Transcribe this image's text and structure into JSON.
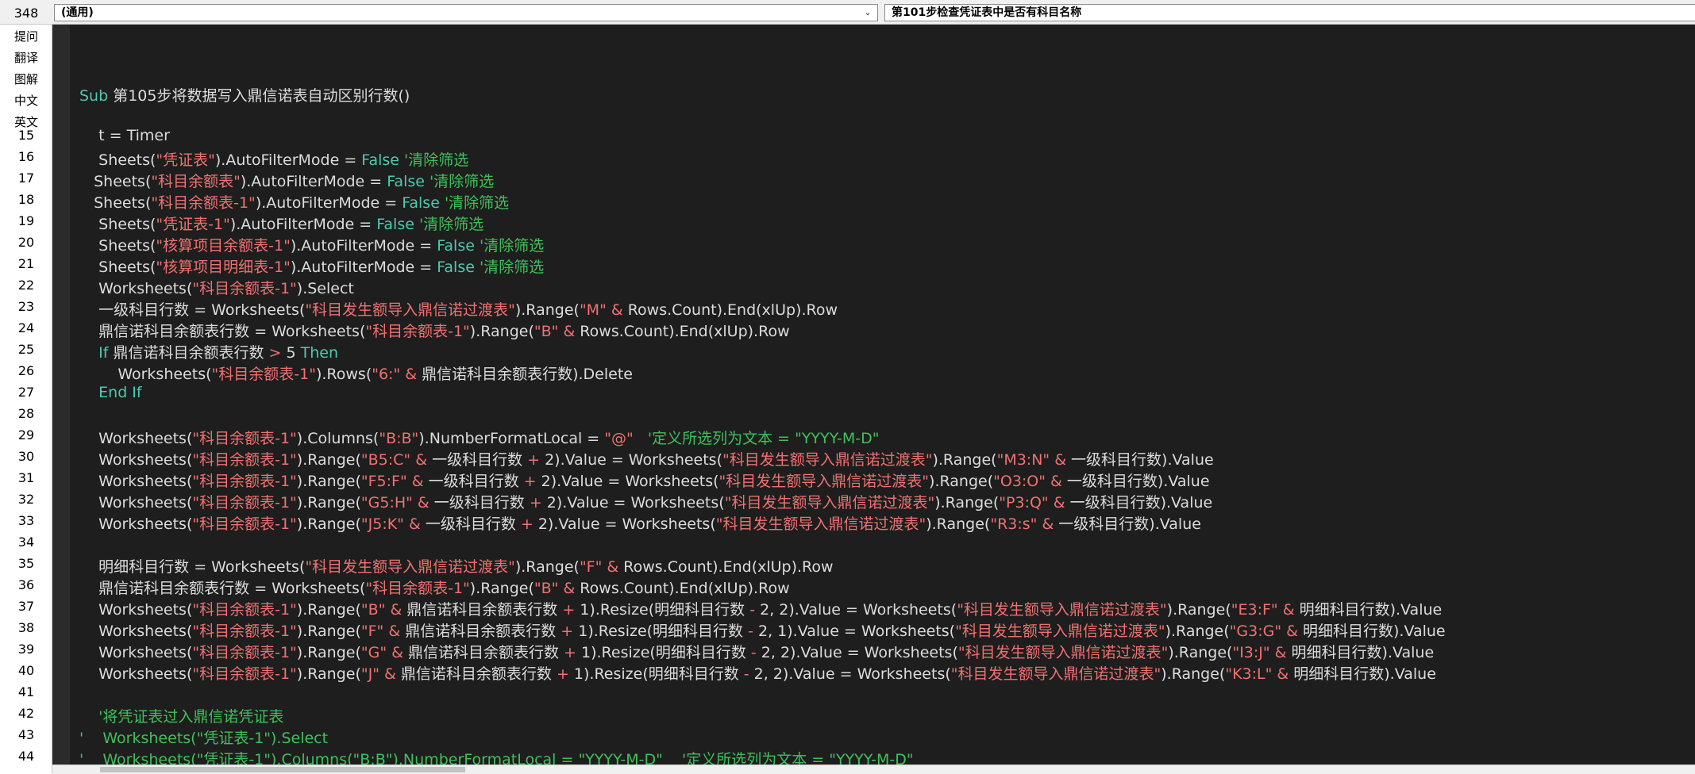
{
  "toolbar": {
    "line_number": "348"
  },
  "object_combo": {
    "value": "(通用)"
  },
  "proc_combo": {
    "value": "第101步检查凭证表中是否有科目名称"
  },
  "sidebar": {
    "tools": [
      "提问",
      "翻译",
      "图解",
      "中文",
      "英文"
    ]
  },
  "line_numbers": [
    "15",
    "16",
    "17",
    "18",
    "19",
    "20",
    "21",
    "22",
    "23",
    "24",
    "25",
    "26",
    "27",
    "28",
    "29",
    "30",
    "31",
    "32",
    "33",
    "34",
    "35",
    "36",
    "37",
    "38",
    "39",
    "40",
    "41",
    "42",
    "43",
    "44"
  ],
  "colors": {
    "keyword": "#4ec9b0",
    "string": "#f07171",
    "comment": "#3fc05a",
    "text": "#dcdcdc",
    "background": "#1e1e1e"
  },
  "code_lines": [
    [],
    [
      [
        "k",
        "Sub"
      ],
      [
        "t",
        " 第105步将数据写入鼎信诺表自动区别行数()"
      ]
    ],
    [],
    [
      [
        "t",
        "    t = Timer"
      ]
    ],
    [
      [
        "t",
        "    Sheets("
      ],
      [
        "s",
        "\"凭证表\""
      ],
      [
        "t",
        ").AutoFilterMode = "
      ],
      [
        "k",
        "False"
      ],
      [
        "c",
        " '清除筛选"
      ]
    ],
    [
      [
        "t",
        "   Sheets("
      ],
      [
        "s",
        "\"科目余额表\""
      ],
      [
        "t",
        ").AutoFilterMode = "
      ],
      [
        "k",
        "False"
      ],
      [
        "c",
        " '清除筛选"
      ]
    ],
    [
      [
        "t",
        "   Sheets("
      ],
      [
        "s",
        "\"科目余额表-1\""
      ],
      [
        "t",
        ").AutoFilterMode = "
      ],
      [
        "k",
        "False"
      ],
      [
        "c",
        " '清除筛选"
      ]
    ],
    [
      [
        "t",
        "    Sheets("
      ],
      [
        "s",
        "\"凭证表-1\""
      ],
      [
        "t",
        ").AutoFilterMode = "
      ],
      [
        "k",
        "False"
      ],
      [
        "c",
        " '清除筛选"
      ]
    ],
    [
      [
        "t",
        "    Sheets("
      ],
      [
        "s",
        "\"核算项目余额表-1\""
      ],
      [
        "t",
        ").AutoFilterMode = "
      ],
      [
        "k",
        "False"
      ],
      [
        "c",
        " '清除筛选"
      ]
    ],
    [
      [
        "t",
        "    Sheets("
      ],
      [
        "s",
        "\"核算项目明细表-1\""
      ],
      [
        "t",
        ").AutoFilterMode = "
      ],
      [
        "k",
        "False"
      ],
      [
        "c",
        " '清除筛选"
      ]
    ],
    [
      [
        "t",
        "    Worksheets("
      ],
      [
        "s",
        "\"科目余额表-1\""
      ],
      [
        "t",
        ").Select"
      ]
    ],
    [
      [
        "t",
        "    一级科目行数 = Worksheets("
      ],
      [
        "s",
        "\"科目发生额导入鼎信诺过渡表\""
      ],
      [
        "t",
        ").Range("
      ],
      [
        "s",
        "\"M\""
      ],
      [
        "o",
        " &"
      ],
      [
        "t",
        " Rows.Count).End(xlUp).Row"
      ]
    ],
    [
      [
        "t",
        "    鼎信诺科目余额表行数 = Worksheets("
      ],
      [
        "s",
        "\"科目余额表-1\""
      ],
      [
        "t",
        ").Range("
      ],
      [
        "s",
        "\"B\""
      ],
      [
        "o",
        " &"
      ],
      [
        "t",
        " Rows.Count).End(xlUp).Row"
      ]
    ],
    [
      [
        "k",
        "    If"
      ],
      [
        "t",
        " 鼎信诺科目余额表行数 "
      ],
      [
        "o",
        ">"
      ],
      [
        "t",
        " 5 "
      ],
      [
        "k",
        "Then"
      ]
    ],
    [
      [
        "t",
        "        Worksheets("
      ],
      [
        "s",
        "\"科目余额表-1\""
      ],
      [
        "t",
        ").Rows("
      ],
      [
        "s",
        "\"6:\""
      ],
      [
        "o",
        " &"
      ],
      [
        "t",
        " 鼎信诺科目余额表行数).Delete"
      ]
    ],
    [
      [
        "k",
        "    End If"
      ]
    ],
    [],
    [
      [
        "t",
        "    Worksheets("
      ],
      [
        "s",
        "\"科目余额表-1\""
      ],
      [
        "t",
        ").Columns("
      ],
      [
        "s",
        "\"B:B\""
      ],
      [
        "t",
        ").NumberFormatLocal = "
      ],
      [
        "s",
        "\"@\""
      ],
      [
        "c",
        "   '定义所选列为文本 = \"YYYY-M-D\""
      ]
    ],
    [
      [
        "t",
        "    Worksheets("
      ],
      [
        "s",
        "\"科目余额表-1\""
      ],
      [
        "t",
        ").Range("
      ],
      [
        "s",
        "\"B5:C\""
      ],
      [
        "o",
        " &"
      ],
      [
        "t",
        " 一级科目行数 "
      ],
      [
        "o",
        "+"
      ],
      [
        "t",
        " 2).Value = Worksheets("
      ],
      [
        "s",
        "\"科目发生额导入鼎信诺过渡表\""
      ],
      [
        "t",
        ").Range("
      ],
      [
        "s",
        "\"M3:N\""
      ],
      [
        "o",
        " &"
      ],
      [
        "t",
        " 一级科目行数).Value"
      ]
    ],
    [
      [
        "t",
        "    Worksheets("
      ],
      [
        "s",
        "\"科目余额表-1\""
      ],
      [
        "t",
        ").Range("
      ],
      [
        "s",
        "\"F5:F\""
      ],
      [
        "o",
        " &"
      ],
      [
        "t",
        " 一级科目行数 "
      ],
      [
        "o",
        "+"
      ],
      [
        "t",
        " 2).Value = Worksheets("
      ],
      [
        "s",
        "\"科目发生额导入鼎信诺过渡表\""
      ],
      [
        "t",
        ").Range("
      ],
      [
        "s",
        "\"O3:O\""
      ],
      [
        "o",
        " &"
      ],
      [
        "t",
        " 一级科目行数).Value"
      ]
    ],
    [
      [
        "t",
        "    Worksheets("
      ],
      [
        "s",
        "\"科目余额表-1\""
      ],
      [
        "t",
        ").Range("
      ],
      [
        "s",
        "\"G5:H\""
      ],
      [
        "o",
        " &"
      ],
      [
        "t",
        " 一级科目行数 "
      ],
      [
        "o",
        "+"
      ],
      [
        "t",
        " 2).Value = Worksheets("
      ],
      [
        "s",
        "\"科目发生额导入鼎信诺过渡表\""
      ],
      [
        "t",
        ").Range("
      ],
      [
        "s",
        "\"P3:Q\""
      ],
      [
        "o",
        " &"
      ],
      [
        "t",
        " 一级科目行数).Value"
      ]
    ],
    [
      [
        "t",
        "    Worksheets("
      ],
      [
        "s",
        "\"科目余额表-1\""
      ],
      [
        "t",
        ").Range("
      ],
      [
        "s",
        "\"J5:K\""
      ],
      [
        "o",
        " &"
      ],
      [
        "t",
        " 一级科目行数 "
      ],
      [
        "o",
        "+"
      ],
      [
        "t",
        " 2).Value = Worksheets("
      ],
      [
        "s",
        "\"科目发生额导入鼎信诺过渡表\""
      ],
      [
        "t",
        ").Range("
      ],
      [
        "s",
        "\"R3:s\""
      ],
      [
        "o",
        " &"
      ],
      [
        "t",
        " 一级科目行数).Value"
      ]
    ],
    [],
    [
      [
        "t",
        "    明细科目行数 = Worksheets("
      ],
      [
        "s",
        "\"科目发生额导入鼎信诺过渡表\""
      ],
      [
        "t",
        ").Range("
      ],
      [
        "s",
        "\"F\""
      ],
      [
        "o",
        " &"
      ],
      [
        "t",
        " Rows.Count).End(xlUp).Row"
      ]
    ],
    [
      [
        "t",
        "    鼎信诺科目余额表行数 = Worksheets("
      ],
      [
        "s",
        "\"科目余额表-1\""
      ],
      [
        "t",
        ").Range("
      ],
      [
        "s",
        "\"B\""
      ],
      [
        "o",
        " &"
      ],
      [
        "t",
        " Rows.Count).End(xlUp).Row"
      ]
    ],
    [
      [
        "t",
        "    Worksheets("
      ],
      [
        "s",
        "\"科目余额表-1\""
      ],
      [
        "t",
        ").Range("
      ],
      [
        "s",
        "\"B\""
      ],
      [
        "o",
        " &"
      ],
      [
        "t",
        " 鼎信诺科目余额表行数 "
      ],
      [
        "o",
        "+"
      ],
      [
        "t",
        " 1).Resize(明细科目行数 "
      ],
      [
        "o",
        "-"
      ],
      [
        "t",
        " 2, 2).Value = Worksheets("
      ],
      [
        "s",
        "\"科目发生额导入鼎信诺过渡表\""
      ],
      [
        "t",
        ").Range("
      ],
      [
        "s",
        "\"E3:F\""
      ],
      [
        "o",
        " &"
      ],
      [
        "t",
        " 明细科目行数).Value"
      ]
    ],
    [
      [
        "t",
        "    Worksheets("
      ],
      [
        "s",
        "\"科目余额表-1\""
      ],
      [
        "t",
        ").Range("
      ],
      [
        "s",
        "\"F\""
      ],
      [
        "o",
        " &"
      ],
      [
        "t",
        " 鼎信诺科目余额表行数 "
      ],
      [
        "o",
        "+"
      ],
      [
        "t",
        " 1).Resize(明细科目行数 "
      ],
      [
        "o",
        "-"
      ],
      [
        "t",
        " 2, 1).Value = Worksheets("
      ],
      [
        "s",
        "\"科目发生额导入鼎信诺过渡表\""
      ],
      [
        "t",
        ").Range("
      ],
      [
        "s",
        "\"G3:G\""
      ],
      [
        "o",
        " &"
      ],
      [
        "t",
        " 明细科目行数).Value"
      ]
    ],
    [
      [
        "t",
        "    Worksheets("
      ],
      [
        "s",
        "\"科目余额表-1\""
      ],
      [
        "t",
        ").Range("
      ],
      [
        "s",
        "\"G\""
      ],
      [
        "o",
        " &"
      ],
      [
        "t",
        " 鼎信诺科目余额表行数 "
      ],
      [
        "o",
        "+"
      ],
      [
        "t",
        " 1).Resize(明细科目行数 "
      ],
      [
        "o",
        "-"
      ],
      [
        "t",
        " 2, 2).Value = Worksheets("
      ],
      [
        "s",
        "\"科目发生额导入鼎信诺过渡表\""
      ],
      [
        "t",
        ").Range("
      ],
      [
        "s",
        "\"I3:J\""
      ],
      [
        "o",
        " &"
      ],
      [
        "t",
        " 明细科目行数).Value"
      ]
    ],
    [
      [
        "t",
        "    Worksheets("
      ],
      [
        "s",
        "\"科目余额表-1\""
      ],
      [
        "t",
        ").Range("
      ],
      [
        "s",
        "\"J\""
      ],
      [
        "o",
        " &"
      ],
      [
        "t",
        " 鼎信诺科目余额表行数 "
      ],
      [
        "o",
        "+"
      ],
      [
        "t",
        " 1).Resize(明细科目行数 "
      ],
      [
        "o",
        "-"
      ],
      [
        "t",
        " 2, 2).Value = Worksheets("
      ],
      [
        "s",
        "\"科目发生额导入鼎信诺过渡表\""
      ],
      [
        "t",
        ").Range("
      ],
      [
        "s",
        "\"K3:L\""
      ],
      [
        "o",
        " &"
      ],
      [
        "t",
        " 明细科目行数).Value"
      ]
    ],
    [],
    [
      [
        "c",
        "    '将凭证表过入鼎信诺凭证表"
      ]
    ],
    [
      [
        "c",
        "'    Worksheets(\"凭证表-1\").Select"
      ]
    ],
    [
      [
        "c",
        "'    Worksheets(\"凭证表-1\").Columns(\"B:B\").NumberFormatLocal = \"YYYY-M-D\"    '定义所选列为文本 = \"YYYY-M-D\""
      ]
    ],
    []
  ]
}
